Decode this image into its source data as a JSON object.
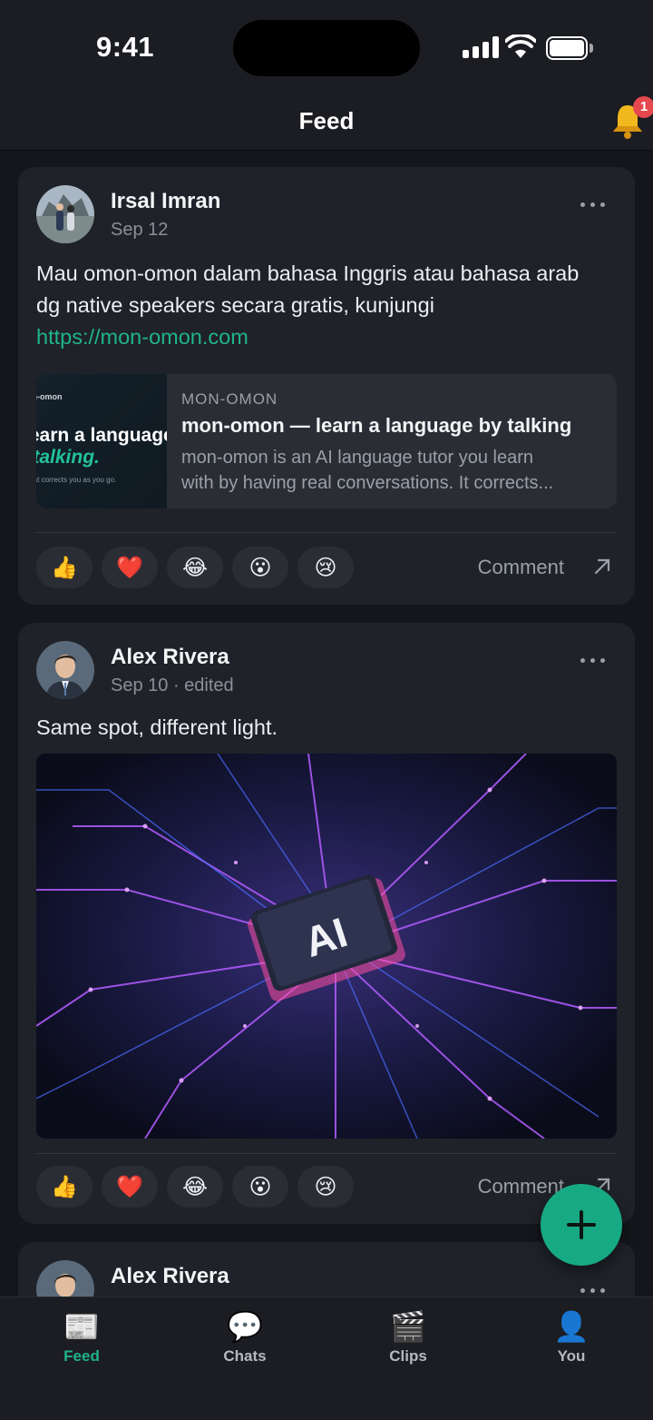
{
  "status_bar": {
    "time": "9:41"
  },
  "header": {
    "title": "Feed",
    "notification_count": "1"
  },
  "posts": [
    {
      "author": "Irsal Imran",
      "date": "Sep 12",
      "text_line1": "Mau omon-omon dalam bahasa Inggris atau bahasa arab",
      "text_line2": "dg native speakers secara gratis, kunjungi",
      "link": "https://mon-omon.com",
      "link_preview": {
        "thumb_brand": "mon-omon",
        "thumb_line1": "learn a language",
        "thumb_line2": "by talking.",
        "thumb_caption": "AI tutor that corrects you as you go.",
        "site": "MON-OMON",
        "title": "mon-omon — learn a language by talking",
        "desc_line1": "mon-omon is an AI language tutor you learn",
        "desc_line2": "with by having real conversations. It corrects..."
      },
      "reactions": [
        "👍",
        "❤️",
        "😂",
        "😮",
        "😢"
      ],
      "comment_label": "Comment"
    },
    {
      "author": "Alex Rivera",
      "date": "Sep 10 · edited",
      "text": "Same spot, different light.",
      "image_text": "AI",
      "reactions": [
        "👍",
        "❤️",
        "😂",
        "😮",
        "😢"
      ],
      "comment_label": "Comment"
    },
    {
      "author": "Alex Rivera"
    }
  ],
  "tabbar": {
    "items": [
      {
        "label": "Feed",
        "icon": "newspaper-icon",
        "glyph": "📰"
      },
      {
        "label": "Chats",
        "icon": "chat-bubble-icon",
        "glyph": "💬"
      },
      {
        "label": "Clips",
        "icon": "clapperboard-icon",
        "glyph": "🎬"
      },
      {
        "label": "You",
        "icon": "person-icon",
        "glyph": "👤"
      }
    ],
    "active": "Feed"
  },
  "colors": {
    "accent": "#1fb388",
    "background": "#14161b",
    "card": "#1f2228",
    "badge": "#e5484d"
  }
}
